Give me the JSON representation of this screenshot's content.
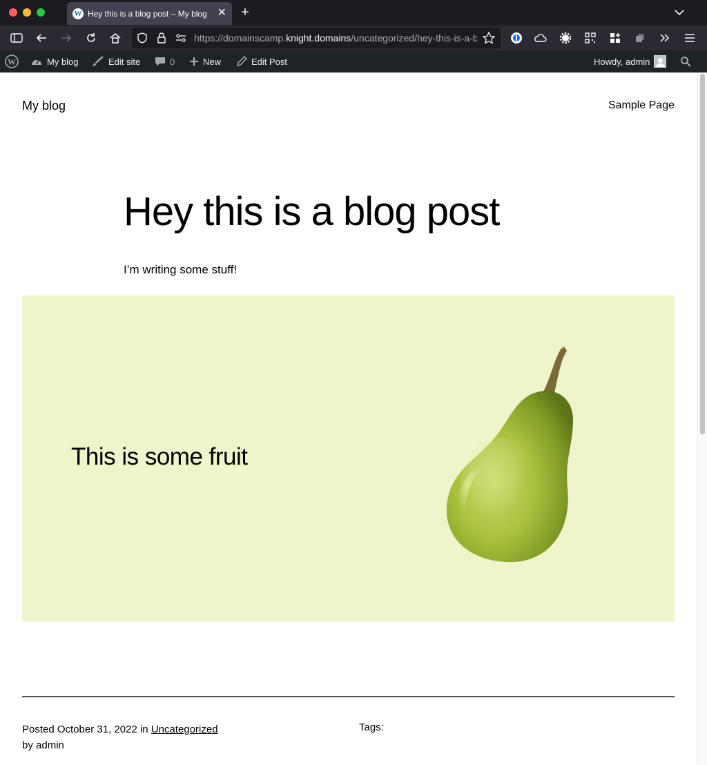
{
  "browser": {
    "tab_title": "Hey this is a blog post – My blog",
    "new_tab": "+",
    "close_tab": "✕",
    "url_prefix": "https://domainscamp.",
    "url_domain": "knight.domains",
    "url_path": "/uncategorized/hey-this-is-a-blog-post/"
  },
  "adminbar": {
    "site_name": "My blog",
    "edit_site": "Edit site",
    "comments_count": "0",
    "new_label": "New",
    "edit_post": "Edit Post",
    "howdy": "Howdy, admin"
  },
  "site": {
    "title": "My blog",
    "nav_item": "Sample Page"
  },
  "post": {
    "title": "Hey this is a blog post",
    "body": "I’m writing some stuff!",
    "cover_heading": "This is some fruit",
    "cover_bg": "#eff4cb",
    "meta": {
      "posted_prefix": "Posted",
      "date": "October 31, 2022",
      "in_label": "in",
      "category": "Uncategorized",
      "by_label": "by",
      "author": "admin",
      "tags_label": "Tags:"
    }
  }
}
